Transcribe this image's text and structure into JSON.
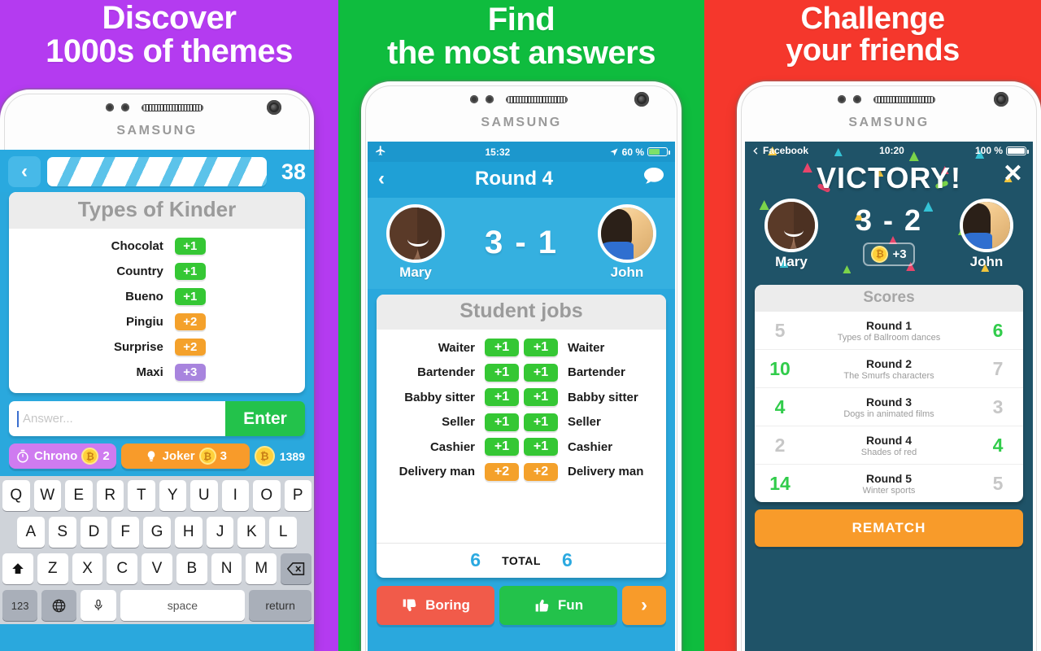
{
  "panels": [
    {
      "bg_color": "#b43bf0",
      "headline_line1": "Discover",
      "headline_line2": "1000s of themes",
      "phone_brand": "SAMSUNG"
    },
    {
      "bg_color": "#0fbc3e",
      "headline_line1": "Find",
      "headline_line2": "the most answers",
      "phone_brand": "SAMSUNG"
    },
    {
      "bg_color": "#f5372c",
      "headline_line1": "Challenge",
      "headline_line2": "your friends",
      "phone_brand": "SAMSUNG"
    }
  ],
  "screen1": {
    "back_icon": "‹",
    "counter": "38",
    "card_title": "Types of Kinder",
    "answers": [
      {
        "label": "Chocolat",
        "points": "+1",
        "color": "green"
      },
      {
        "label": "Country",
        "points": "+1",
        "color": "green"
      },
      {
        "label": "Bueno",
        "points": "+1",
        "color": "green"
      },
      {
        "label": "Pingiu",
        "points": "+2",
        "color": "orange"
      },
      {
        "label": "Surprise",
        "points": "+2",
        "color": "orange"
      },
      {
        "label": "Maxi",
        "points": "+3",
        "color": "purple"
      }
    ],
    "input_placeholder": "Answer...",
    "input_value": "",
    "enter_label": "Enter",
    "powerups": [
      {
        "name": "Chrono",
        "count": "2",
        "color": "#cf7bf0",
        "icon": "stopwatch-icon"
      },
      {
        "name": "Joker",
        "count": "3",
        "color": "#f89b2a",
        "icon": "lightbulb-icon"
      }
    ],
    "coin_balance": "1389",
    "coin_symbol": "₿",
    "keyboard": {
      "row1": [
        "Q",
        "W",
        "E",
        "R",
        "T",
        "Y",
        "U",
        "I",
        "O",
        "P"
      ],
      "row2": [
        "A",
        "S",
        "D",
        "F",
        "G",
        "H",
        "J",
        "K",
        "L"
      ],
      "row3": [
        "Z",
        "X",
        "C",
        "V",
        "B",
        "N",
        "M"
      ],
      "shift_label": "⬆",
      "backspace_label": "⌫",
      "numeric_label": "123",
      "globe_label": "ἱ0",
      "mic_label": "Ἲ4",
      "space_label": "space",
      "return_label": "return"
    }
  },
  "screen2": {
    "status_time": "15:32",
    "status_battery": "60 %",
    "status_airplane": "airplane-icon",
    "nav_back": "‹",
    "nav_title": "Round 4",
    "nav_chat": "chat-bubble-icon",
    "player_left": "Mary",
    "player_right": "John",
    "score": "3 - 1",
    "card_title": "Student jobs",
    "rows": [
      {
        "left": "Waiter",
        "lp": "+1",
        "lc": "green",
        "rp": "+1",
        "rc": "green",
        "right": "Waiter"
      },
      {
        "left": "Bartender",
        "lp": "+1",
        "lc": "green",
        "rp": "+1",
        "rc": "green",
        "right": "Bartender"
      },
      {
        "left": "Babby sitter",
        "lp": "+1",
        "lc": "green",
        "rp": "+1",
        "rc": "green",
        "right": "Babby sitter"
      },
      {
        "left": "Seller",
        "lp": "+1",
        "lc": "green",
        "rp": "+1",
        "rc": "green",
        "right": "Seller"
      },
      {
        "left": "Cashier",
        "lp": "+1",
        "lc": "green",
        "rp": "+1",
        "rc": "green",
        "right": "Cashier"
      },
      {
        "left": "Delivery man",
        "lp": "+2",
        "lc": "orange",
        "rp": "+2",
        "rc": "orange",
        "right": "Delivery man"
      }
    ],
    "total_left": "6",
    "total_label": "TOTAL",
    "total_right": "6",
    "boring_label": "Boring",
    "fun_label": "Fun",
    "next_label": "›"
  },
  "screen3": {
    "status_back_app": "Facebook",
    "status_time": "10:20",
    "status_battery": "100 %",
    "victory_title": "VICTORY!",
    "close_label": "✕",
    "player_left": "Mary",
    "player_right": "John",
    "score": "3 - 2",
    "gain": "+3",
    "coin_symbol": "₿",
    "scores_header": "Scores",
    "rounds": [
      {
        "left": "5",
        "left_win": false,
        "round": "Round 1",
        "theme": "Types of Ballroom dances",
        "right": "6",
        "right_win": true
      },
      {
        "left": "10",
        "left_win": true,
        "round": "Round 2",
        "theme": "The Smurfs characters",
        "right": "7",
        "right_win": false
      },
      {
        "left": "4",
        "left_win": true,
        "round": "Round 3",
        "theme": "Dogs in animated films",
        "right": "3",
        "right_win": false
      },
      {
        "left": "2",
        "left_win": false,
        "round": "Round 4",
        "theme": "Shades of red",
        "right": "4",
        "right_win": true
      },
      {
        "left": "14",
        "left_win": true,
        "round": "Round 5",
        "theme": "Winter sports",
        "right": "5",
        "right_win": false
      }
    ],
    "rematch_label": "REMATCH"
  },
  "colors": {
    "purple_bg": "#b43bf0",
    "green_bg": "#0fbc3e",
    "red_bg": "#f5372c",
    "app_blue": "#2aa8dd",
    "badge_green": "#35c734",
    "badge_orange": "#f4a12b",
    "badge_purple": "#a884de",
    "enter_green": "#23c24b",
    "victory_bg": "#1f5368",
    "rematch_orange": "#f89b2a"
  }
}
